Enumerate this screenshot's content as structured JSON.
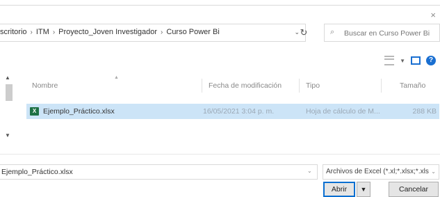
{
  "dialog": {
    "close_glyph": "×"
  },
  "address": {
    "crumbs": [
      "scritorio",
      "ITM",
      "Proyecto_Joven Investigador",
      "Curso Power Bi"
    ],
    "separator": "›"
  },
  "search": {
    "placeholder": "Buscar en Curso Power Bi"
  },
  "columns": {
    "name": "Nombre",
    "date": "Fecha de modificación",
    "type": "Tipo",
    "size": "Tamaño"
  },
  "files": [
    {
      "name": "Ejemplo_Práctico.xlsx",
      "date": "16/05/2021 3:04 p. m.",
      "type": "Hoja de cálculo de M...",
      "size": "288 KB",
      "icon": "excel-icon",
      "selected": true
    }
  ],
  "footer": {
    "filename_value": "Ejemplo_Práctico.xlsx",
    "filter_label": "Archivos de Excel (*.xl;*.xlsx;*.xls",
    "open_label": "Abrir",
    "cancel_label": "Cancelar"
  },
  "colors": {
    "selection": "#cce4f7",
    "accent": "#1a6fd1",
    "excel_green": "#1e7145"
  }
}
